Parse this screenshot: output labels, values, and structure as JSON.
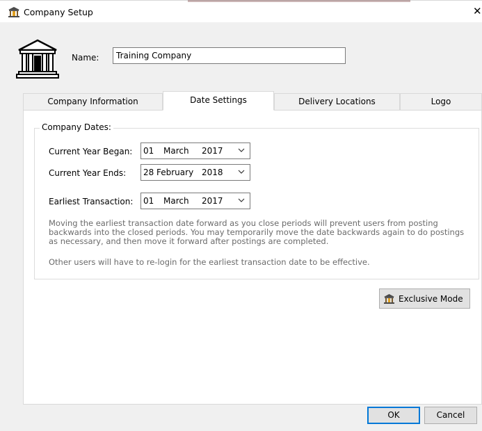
{
  "window": {
    "title": "Company Setup",
    "close_glyph": "✕",
    "app_icon": "bank-icon"
  },
  "company": {
    "name_label": "Name:",
    "name_value": "Training Company",
    "logo_icon": "bank-building-icon"
  },
  "tabs": [
    {
      "label": "Company Information",
      "active": false
    },
    {
      "label": "Date Settings",
      "active": true
    },
    {
      "label": "Delivery Locations",
      "active": false
    },
    {
      "label": "Logo",
      "active": false
    }
  ],
  "date_settings": {
    "group_title": "Company Dates:",
    "current_year_began": {
      "label": "Current Year Began:",
      "day": "01",
      "month": "March",
      "year": "2017"
    },
    "current_year_ends": {
      "label": "Current Year Ends:",
      "day": "28",
      "month": "February",
      "year": "2018"
    },
    "earliest_transaction": {
      "label": "Earliest Transaction:",
      "day": "01",
      "month": "March",
      "year": "2017"
    },
    "notice_1": "Moving the earliest transaction date forward as you close periods will prevent users from posting backwards into the closed periods. You may temporarily move the date backwards again to do postings as necessary, and then move it forward after postings are completed.",
    "notice_2": "Other users will have to re-login for the earliest transaction date to be effective."
  },
  "buttons": {
    "exclusive_mode": "Exclusive Mode",
    "ok": "OK",
    "cancel": "Cancel"
  },
  "colors": {
    "accent": "#0078d7",
    "window_bg": "#f0f0f0",
    "notice_text": "#6b6b6b"
  }
}
